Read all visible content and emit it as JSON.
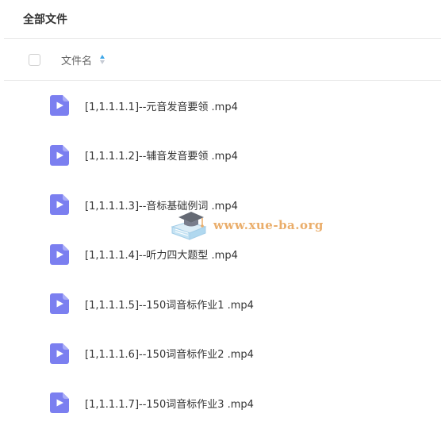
{
  "header": {
    "title": "全部文件"
  },
  "table": {
    "column_name": "文件名",
    "sort_icon": "sort-ascending-icon",
    "accent_color": "#3fa7e8",
    "rows": [
      {
        "name": "[1,1.1.1.1]--元音发音要领 .mp4",
        "icon": "video-file-icon"
      },
      {
        "name": "[1,1.1.1.2]--辅音发音要领 .mp4",
        "icon": "video-file-icon"
      },
      {
        "name": "[1,1.1.1.3]--音标基础例词 .mp4",
        "icon": "video-file-icon"
      },
      {
        "name": "[1,1.1.1.4]--听力四大题型 .mp4",
        "icon": "video-file-icon"
      },
      {
        "name": "[1,1.1.1.5]--150词音标作业1 .mp4",
        "icon": "video-file-icon"
      },
      {
        "name": "[1,1.1.1.6]--150词音标作业2 .mp4",
        "icon": "video-file-icon"
      },
      {
        "name": "[1,1.1.1.7]--150词音标作业3 .mp4",
        "icon": "video-file-icon"
      }
    ]
  },
  "watermark": {
    "text": "www.xue-ba.org"
  },
  "colors": {
    "video_icon": "#7b7ff0",
    "watermark_text": "#e8a55a"
  }
}
